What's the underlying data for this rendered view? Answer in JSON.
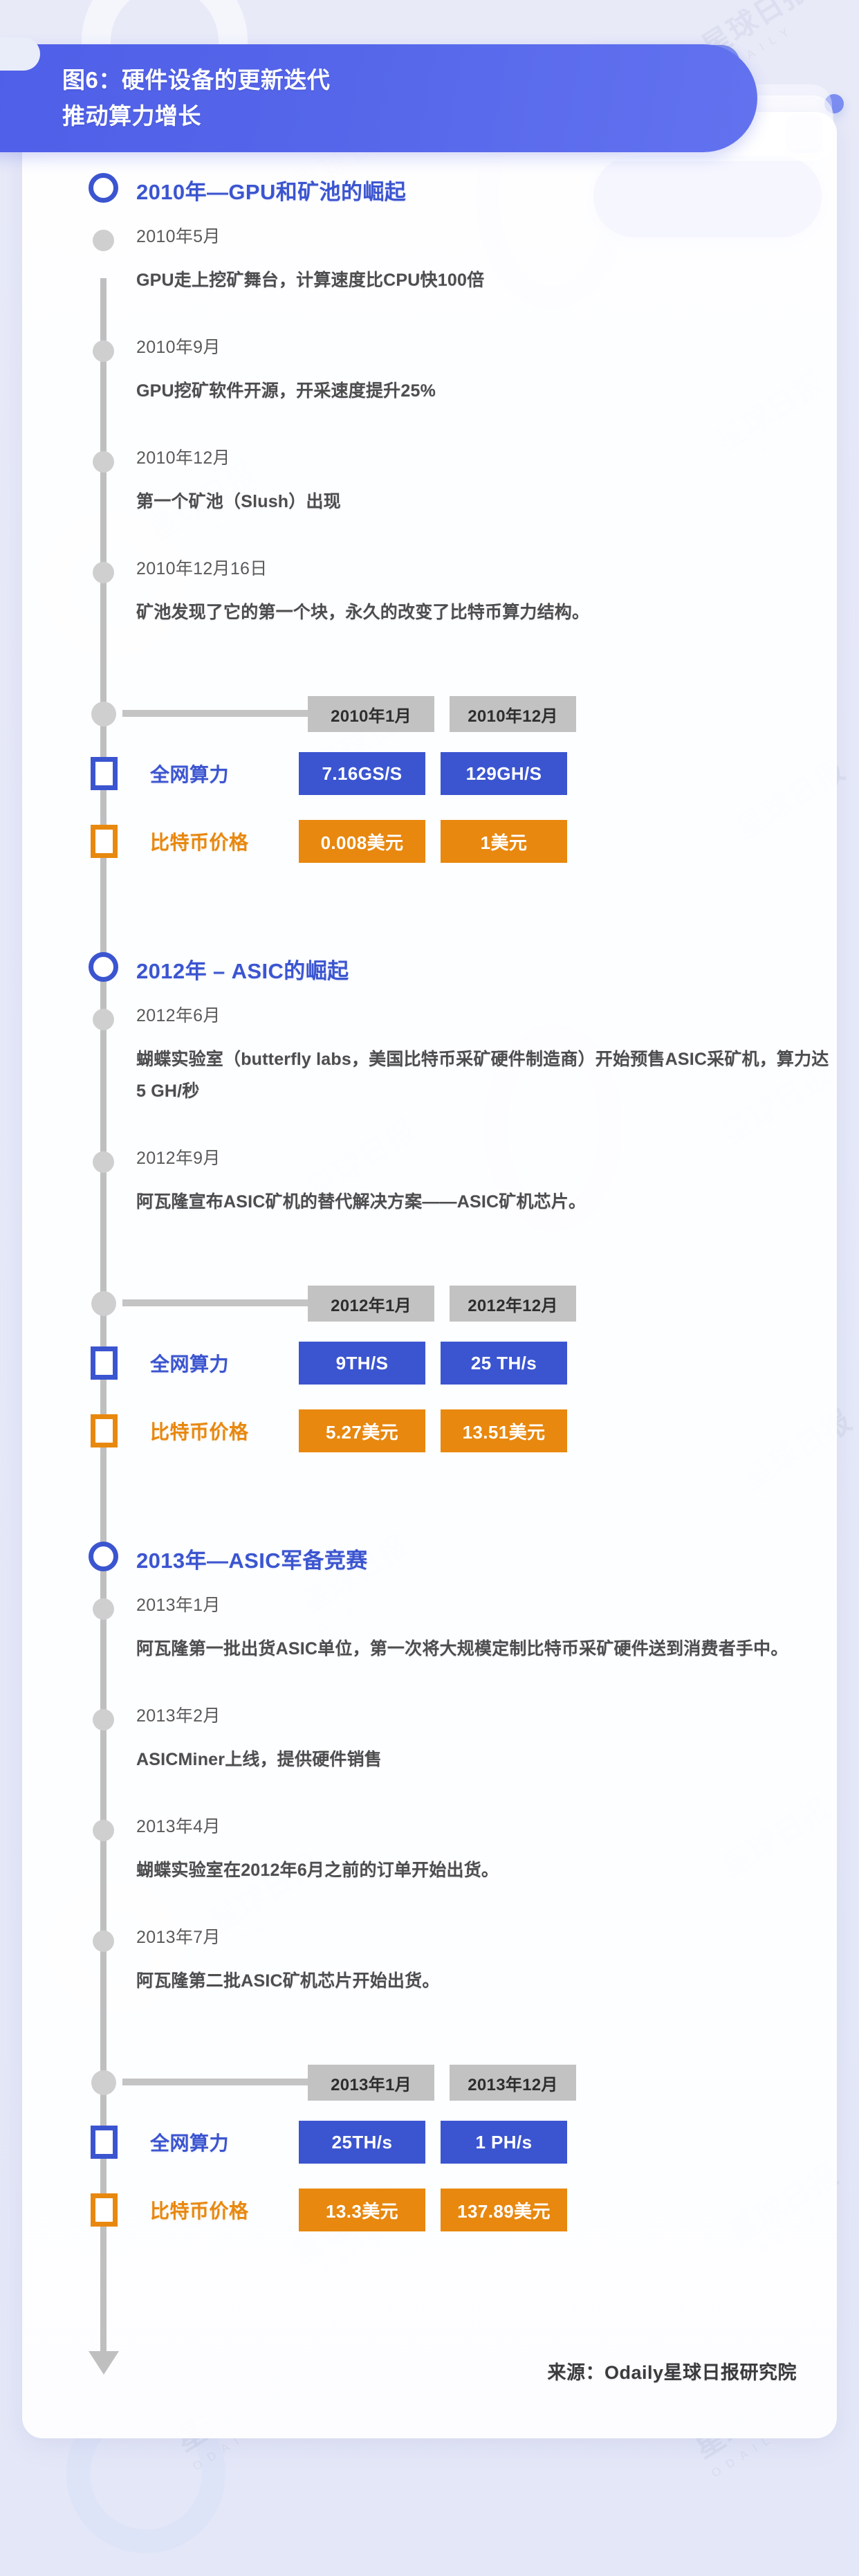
{
  "header": {
    "title_line1": "图6：硬件设备的更新迭代",
    "title_line2": "推动算力增长",
    "title_full": "图6：硬件设备的更新迭代\n推动算力增长"
  },
  "colors": {
    "brand_blue": "#3b55d0",
    "banner_blue": "#5566ea",
    "accent_orange": "#e8880f",
    "timeline_gray": "#bfbfbf",
    "header_cell_gray": "#c2c2c2",
    "page_bg": "#e6e9f7",
    "card_bg": "#ffffff",
    "deco_purple": "#7b8df0"
  },
  "watermark": {
    "text": "星球日报",
    "sub": "ODAILY"
  },
  "sections": [
    {
      "title": "2010年—GPU和矿池的崛起",
      "events": [
        {
          "date": "2010年5月",
          "text": "GPU走上挖矿舞台，计算速度比CPU快100倍"
        },
        {
          "date": "2010年9月",
          "text": "GPU挖矿软件开源，开采速度提升25%"
        },
        {
          "date": "2010年12月",
          "text": "第一个矿池（Slush）出现"
        },
        {
          "date": "2010年12月16日",
          "text": "矿池发现了它的第一个块，永久的改变了比特币算力结构。"
        }
      ],
      "table": {
        "col_headers": [
          "2010年1月",
          "2010年12月"
        ],
        "rows": [
          {
            "label": "全网算力",
            "kind": "blue",
            "values": [
              "7.16GS/S",
              "129GH/S"
            ]
          },
          {
            "label": "比特币价格",
            "kind": "orange",
            "values": [
              "0.008美元",
              "1美元"
            ]
          }
        ]
      }
    },
    {
      "title": "2012年 – ASIC的崛起",
      "events": [
        {
          "date": "2012年6月",
          "text": "蝴蝶实验室（butterfly labs，美国比特币采矿硬件制造商）开始预售ASIC采矿机，算力达5 GH/秒"
        },
        {
          "date": "2012年9月",
          "text": "阿瓦隆宣布ASIC矿机的替代解决方案——ASIC矿机芯片。"
        }
      ],
      "table": {
        "col_headers": [
          "2012年1月",
          "2012年12月"
        ],
        "rows": [
          {
            "label": "全网算力",
            "kind": "blue",
            "values": [
              "9TH/S",
              "25 TH/s"
            ]
          },
          {
            "label": "比特币价格",
            "kind": "orange",
            "values": [
              "5.27美元",
              "13.51美元"
            ]
          }
        ]
      }
    },
    {
      "title": "2013年—ASIC军备竞赛",
      "events": [
        {
          "date": "2013年1月",
          "text": "阿瓦隆第一批出货ASIC单位，第一次将大规模定制比特币采矿硬件送到消费者手中。"
        },
        {
          "date": "2013年2月",
          "text": "ASICMiner上线，提供硬件销售"
        },
        {
          "date": "2013年4月",
          "text": "蝴蝶实验室在2012年6月之前的订单开始出货。"
        },
        {
          "date": "2013年7月",
          "text": "阿瓦隆第二批ASIC矿机芯片开始出货。"
        }
      ],
      "table": {
        "col_headers": [
          "2013年1月",
          "2013年12月"
        ],
        "rows": [
          {
            "label": "全网算力",
            "kind": "blue",
            "values": [
              "25TH/s",
              "1 PH/s"
            ]
          },
          {
            "label": "比特币价格",
            "kind": "orange",
            "values": [
              "13.3美元",
              "137.89美元"
            ]
          }
        ]
      }
    }
  ],
  "footer": {
    "source": "来源：Odaily星球日报研究院"
  }
}
